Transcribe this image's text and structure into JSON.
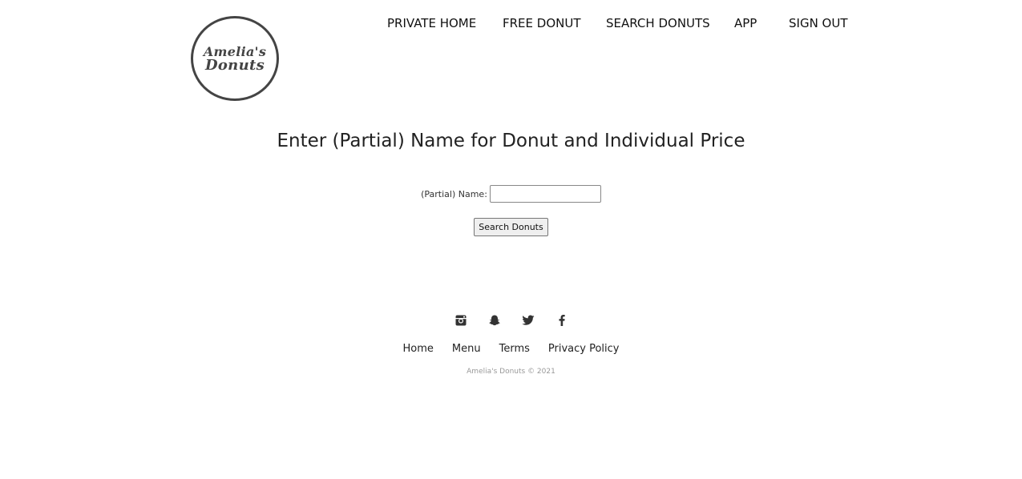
{
  "logo": {
    "line1": "Amelia's",
    "line2": "Donuts"
  },
  "nav": {
    "items": [
      {
        "label": "PRIVATE HOME"
      },
      {
        "label": "FREE DONUT"
      },
      {
        "label": "SEARCH DONUTS"
      },
      {
        "label": "APP"
      },
      {
        "label": "SIGN OUT"
      }
    ]
  },
  "main": {
    "heading": "Enter (Partial) Name for Donut and Individual Price",
    "name_label": "(Partial) Name:",
    "name_value": "",
    "name_placeholder": "",
    "search_button": "Search Donuts"
  },
  "footer": {
    "social_icons": [
      "instagram-icon",
      "snapchat-icon",
      "twitter-icon",
      "facebook-icon"
    ],
    "links": [
      {
        "label": "Home"
      },
      {
        "label": "Menu"
      },
      {
        "label": "Terms"
      },
      {
        "label": "Privacy Policy"
      }
    ],
    "copyright": "Amelia's Donuts © 2021"
  }
}
